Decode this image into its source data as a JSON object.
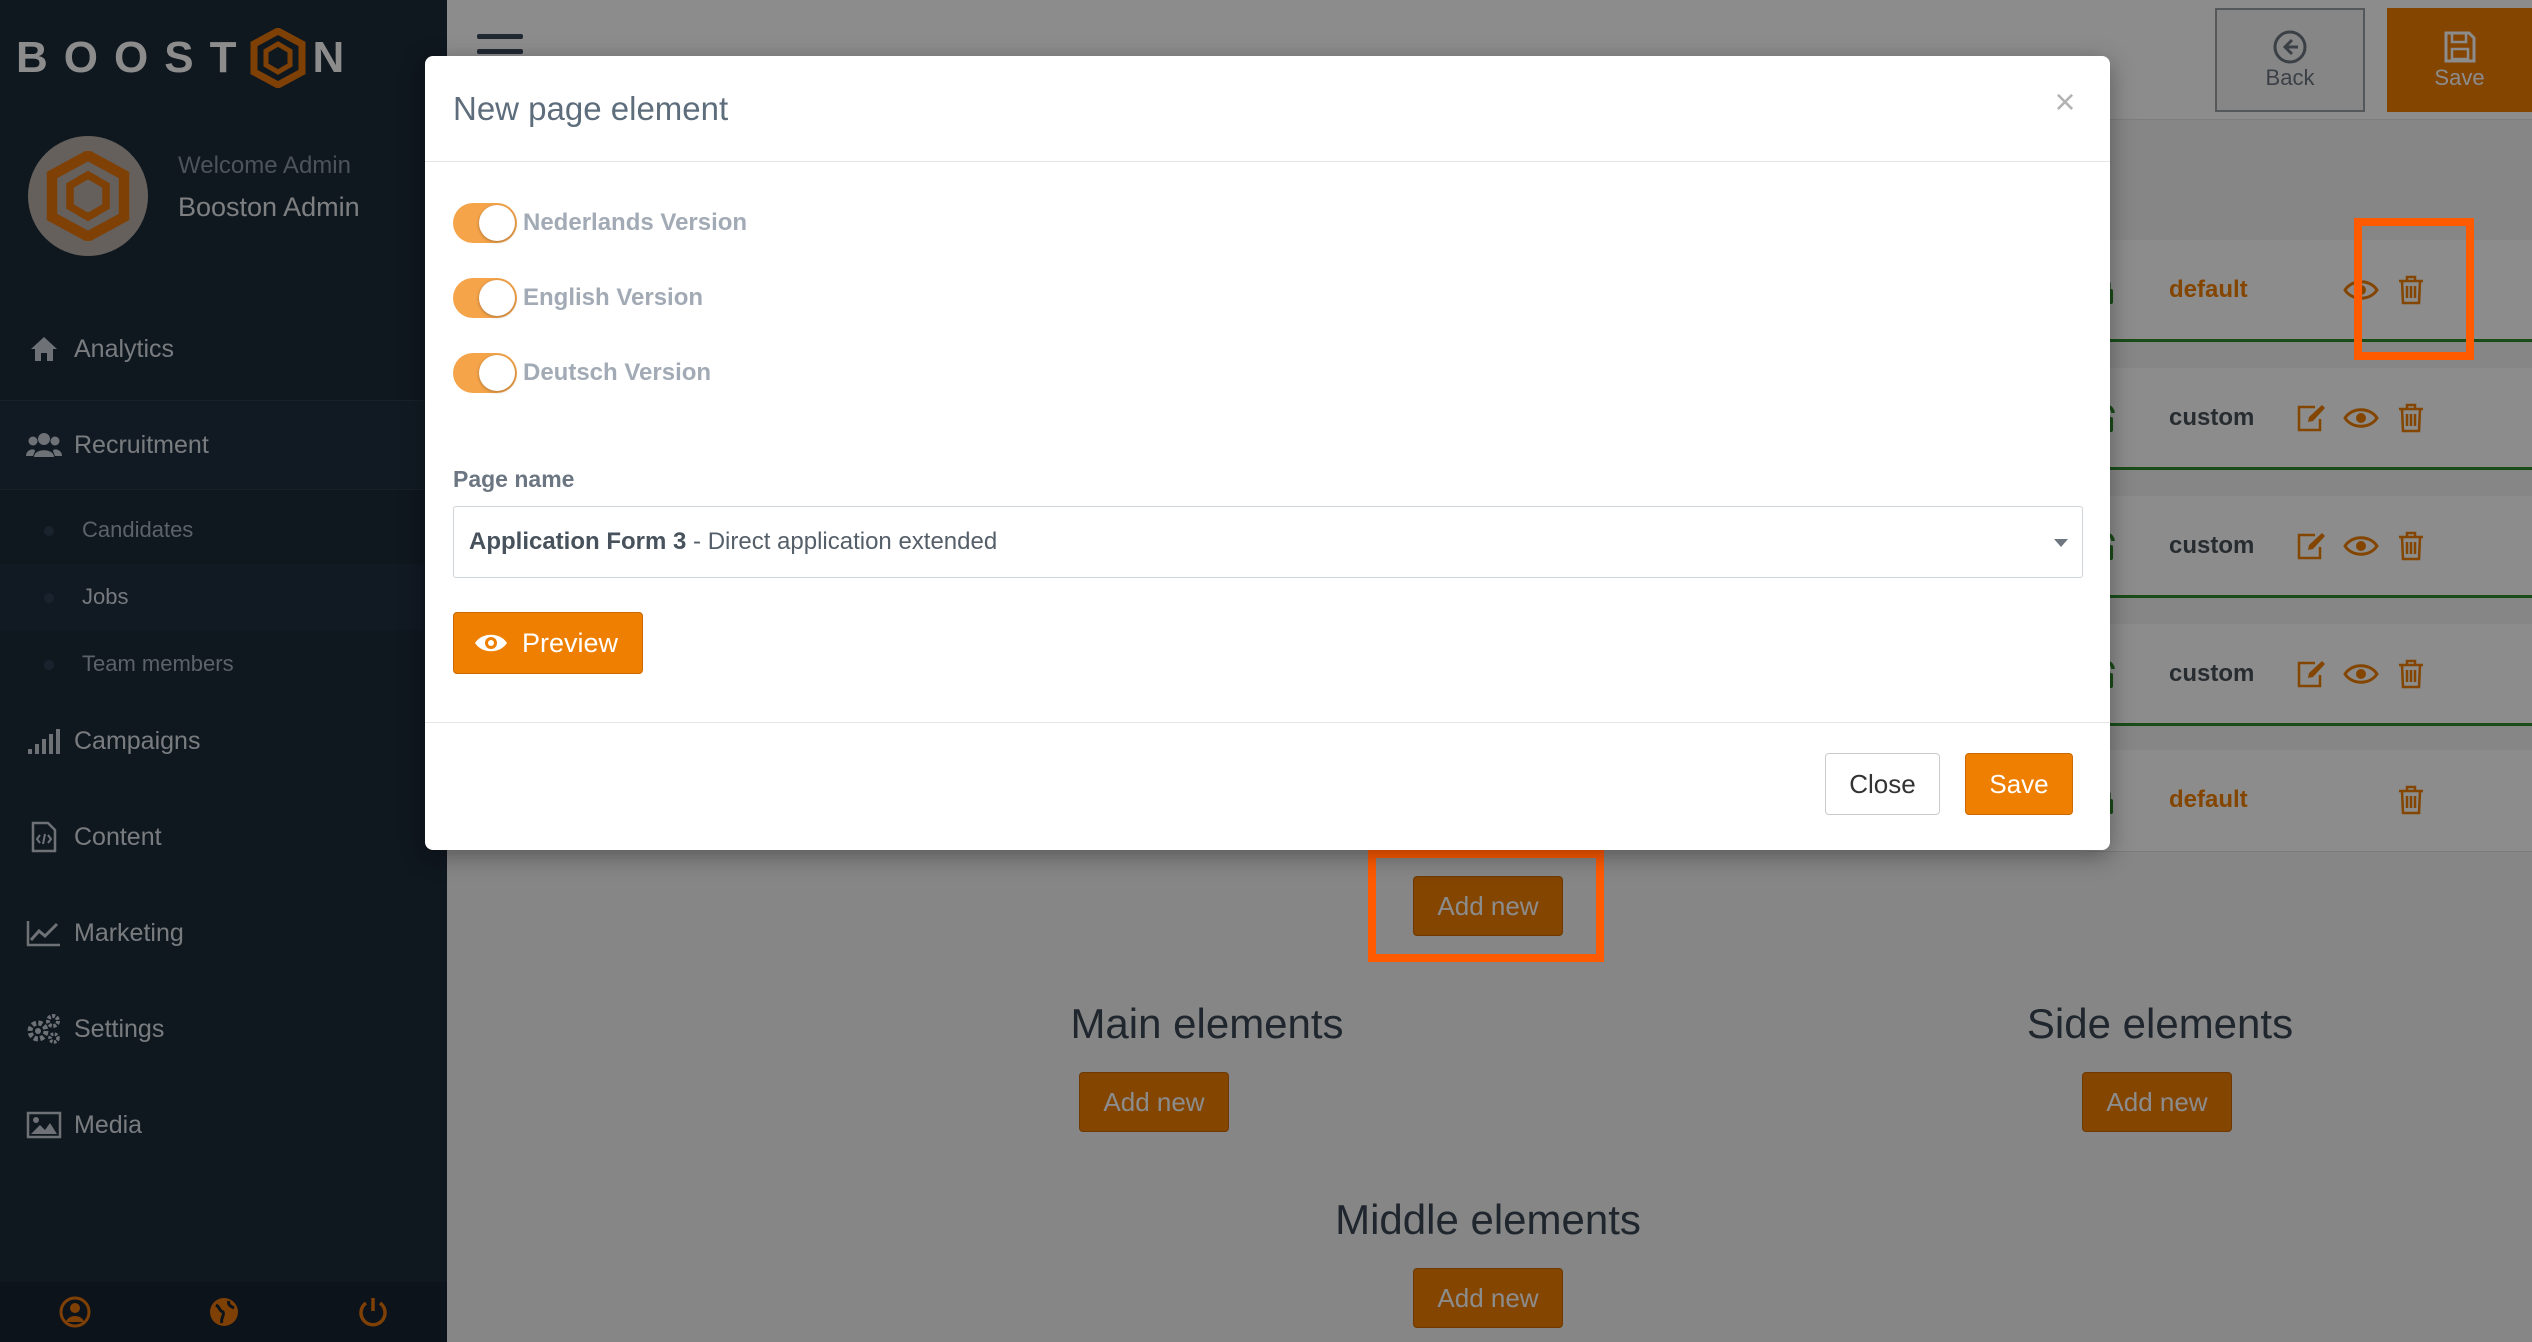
{
  "brand": {
    "logo_left": "BOOST",
    "logo_right": "N",
    "accent": "#ef7f00",
    "sidebar_bg": "#1c2a39"
  },
  "profile": {
    "welcome": "Welcome Admin",
    "name": "Booston Admin"
  },
  "sidebar": {
    "items": [
      {
        "label": "Analytics",
        "icon": "home-icon"
      },
      {
        "label": "Recruitment",
        "icon": "users-icon"
      },
      {
        "label": "Campaigns",
        "icon": "signal-bars-icon"
      },
      {
        "label": "Content",
        "icon": "code-file-icon"
      },
      {
        "label": "Marketing",
        "icon": "line-chart-icon"
      },
      {
        "label": "Settings",
        "icon": "gears-icon"
      },
      {
        "label": "Media",
        "icon": "image-icon"
      }
    ],
    "subitems": [
      {
        "label": "Candidates"
      },
      {
        "label": "Jobs"
      },
      {
        "label": "Team members"
      }
    ],
    "footer_icons": [
      "user-circle-icon",
      "globe-icon",
      "power-icon"
    ]
  },
  "toolbar": {
    "back_label": "Back",
    "save_label": "Save"
  },
  "rows": [
    {
      "type": "default"
    },
    {
      "type": "custom"
    },
    {
      "type": "custom"
    },
    {
      "type": "custom"
    },
    {
      "type": "default"
    }
  ],
  "sections": {
    "add_new": "Add new",
    "main_title": "Main elements",
    "side_title": "Side elements",
    "middle_title": "Middle elements"
  },
  "modal": {
    "title": "New page element",
    "close_symbol": "×",
    "toggles": [
      {
        "label": "Nederlands Version",
        "on": true
      },
      {
        "label": "English Version",
        "on": true
      },
      {
        "label": "Deutsch Version",
        "on": true
      }
    ],
    "page_name_label": "Page name",
    "select_value_bold": "Application Form 3",
    "select_value_rest": " - Direct application extended",
    "preview_label": "Preview",
    "close_label": "Close",
    "save_label": "Save"
  }
}
